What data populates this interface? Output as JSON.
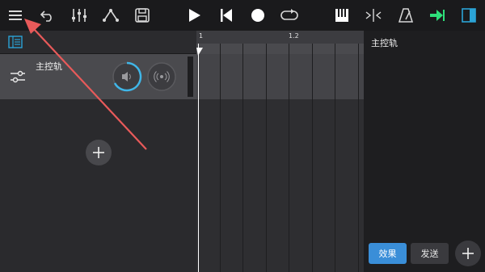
{
  "toolbar": {
    "icons": [
      "menu-icon",
      "undo-icon",
      "mixer-icon",
      "automation-icon",
      "save-icon",
      "play-icon",
      "skip-to-start-icon",
      "record-icon",
      "loop-icon",
      "piano-icon",
      "split-icon",
      "metronome-icon",
      "export-icon",
      "panel-toggle-icon"
    ],
    "accent_color": "#2ee07a",
    "panel_color": "#2ba3d6"
  },
  "left_panel": {
    "track": {
      "name": "主控轨"
    }
  },
  "timeline": {
    "ruler_labels": [
      "1",
      "1.2"
    ]
  },
  "right_panel": {
    "title": "主控轨",
    "effects_label": "效果",
    "send_label": "发送"
  },
  "colors": {
    "active_blue": "#3a8ed8",
    "annotation_red": "#e85a5a"
  }
}
